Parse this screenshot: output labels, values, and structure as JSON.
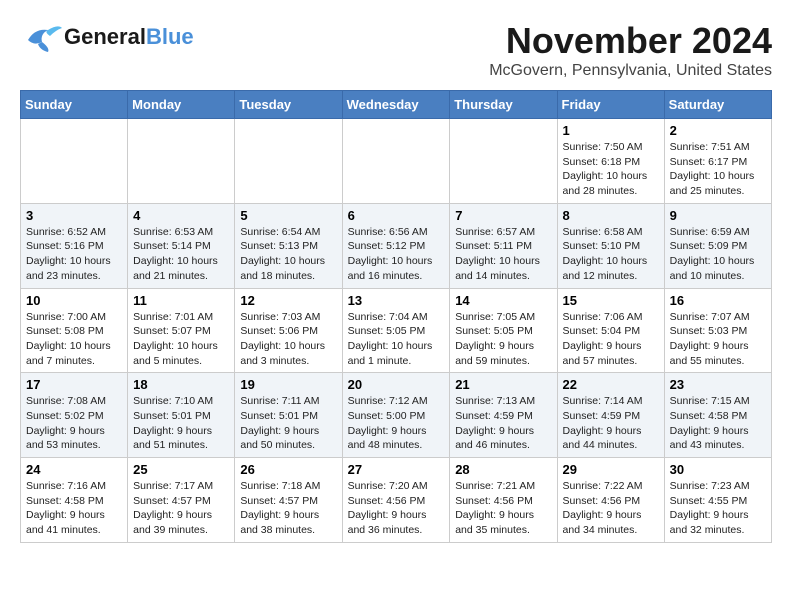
{
  "header": {
    "logo_line1": "General",
    "logo_line2": "Blue",
    "month": "November 2024",
    "location": "McGovern, Pennsylvania, United States"
  },
  "weekdays": [
    "Sunday",
    "Monday",
    "Tuesday",
    "Wednesday",
    "Thursday",
    "Friday",
    "Saturday"
  ],
  "weeks": [
    [
      {
        "day": "",
        "info": ""
      },
      {
        "day": "",
        "info": ""
      },
      {
        "day": "",
        "info": ""
      },
      {
        "day": "",
        "info": ""
      },
      {
        "day": "",
        "info": ""
      },
      {
        "day": "1",
        "info": "Sunrise: 7:50 AM\nSunset: 6:18 PM\nDaylight: 10 hours and 28 minutes."
      },
      {
        "day": "2",
        "info": "Sunrise: 7:51 AM\nSunset: 6:17 PM\nDaylight: 10 hours and 25 minutes."
      }
    ],
    [
      {
        "day": "3",
        "info": "Sunrise: 6:52 AM\nSunset: 5:16 PM\nDaylight: 10 hours and 23 minutes."
      },
      {
        "day": "4",
        "info": "Sunrise: 6:53 AM\nSunset: 5:14 PM\nDaylight: 10 hours and 21 minutes."
      },
      {
        "day": "5",
        "info": "Sunrise: 6:54 AM\nSunset: 5:13 PM\nDaylight: 10 hours and 18 minutes."
      },
      {
        "day": "6",
        "info": "Sunrise: 6:56 AM\nSunset: 5:12 PM\nDaylight: 10 hours and 16 minutes."
      },
      {
        "day": "7",
        "info": "Sunrise: 6:57 AM\nSunset: 5:11 PM\nDaylight: 10 hours and 14 minutes."
      },
      {
        "day": "8",
        "info": "Sunrise: 6:58 AM\nSunset: 5:10 PM\nDaylight: 10 hours and 12 minutes."
      },
      {
        "day": "9",
        "info": "Sunrise: 6:59 AM\nSunset: 5:09 PM\nDaylight: 10 hours and 10 minutes."
      }
    ],
    [
      {
        "day": "10",
        "info": "Sunrise: 7:00 AM\nSunset: 5:08 PM\nDaylight: 10 hours and 7 minutes."
      },
      {
        "day": "11",
        "info": "Sunrise: 7:01 AM\nSunset: 5:07 PM\nDaylight: 10 hours and 5 minutes."
      },
      {
        "day": "12",
        "info": "Sunrise: 7:03 AM\nSunset: 5:06 PM\nDaylight: 10 hours and 3 minutes."
      },
      {
        "day": "13",
        "info": "Sunrise: 7:04 AM\nSunset: 5:05 PM\nDaylight: 10 hours and 1 minute."
      },
      {
        "day": "14",
        "info": "Sunrise: 7:05 AM\nSunset: 5:05 PM\nDaylight: 9 hours and 59 minutes."
      },
      {
        "day": "15",
        "info": "Sunrise: 7:06 AM\nSunset: 5:04 PM\nDaylight: 9 hours and 57 minutes."
      },
      {
        "day": "16",
        "info": "Sunrise: 7:07 AM\nSunset: 5:03 PM\nDaylight: 9 hours and 55 minutes."
      }
    ],
    [
      {
        "day": "17",
        "info": "Sunrise: 7:08 AM\nSunset: 5:02 PM\nDaylight: 9 hours and 53 minutes."
      },
      {
        "day": "18",
        "info": "Sunrise: 7:10 AM\nSunset: 5:01 PM\nDaylight: 9 hours and 51 minutes."
      },
      {
        "day": "19",
        "info": "Sunrise: 7:11 AM\nSunset: 5:01 PM\nDaylight: 9 hours and 50 minutes."
      },
      {
        "day": "20",
        "info": "Sunrise: 7:12 AM\nSunset: 5:00 PM\nDaylight: 9 hours and 48 minutes."
      },
      {
        "day": "21",
        "info": "Sunrise: 7:13 AM\nSunset: 4:59 PM\nDaylight: 9 hours and 46 minutes."
      },
      {
        "day": "22",
        "info": "Sunrise: 7:14 AM\nSunset: 4:59 PM\nDaylight: 9 hours and 44 minutes."
      },
      {
        "day": "23",
        "info": "Sunrise: 7:15 AM\nSunset: 4:58 PM\nDaylight: 9 hours and 43 minutes."
      }
    ],
    [
      {
        "day": "24",
        "info": "Sunrise: 7:16 AM\nSunset: 4:58 PM\nDaylight: 9 hours and 41 minutes."
      },
      {
        "day": "25",
        "info": "Sunrise: 7:17 AM\nSunset: 4:57 PM\nDaylight: 9 hours and 39 minutes."
      },
      {
        "day": "26",
        "info": "Sunrise: 7:18 AM\nSunset: 4:57 PM\nDaylight: 9 hours and 38 minutes."
      },
      {
        "day": "27",
        "info": "Sunrise: 7:20 AM\nSunset: 4:56 PM\nDaylight: 9 hours and 36 minutes."
      },
      {
        "day": "28",
        "info": "Sunrise: 7:21 AM\nSunset: 4:56 PM\nDaylight: 9 hours and 35 minutes."
      },
      {
        "day": "29",
        "info": "Sunrise: 7:22 AM\nSunset: 4:56 PM\nDaylight: 9 hours and 34 minutes."
      },
      {
        "day": "30",
        "info": "Sunrise: 7:23 AM\nSunset: 4:55 PM\nDaylight: 9 hours and 32 minutes."
      }
    ]
  ]
}
